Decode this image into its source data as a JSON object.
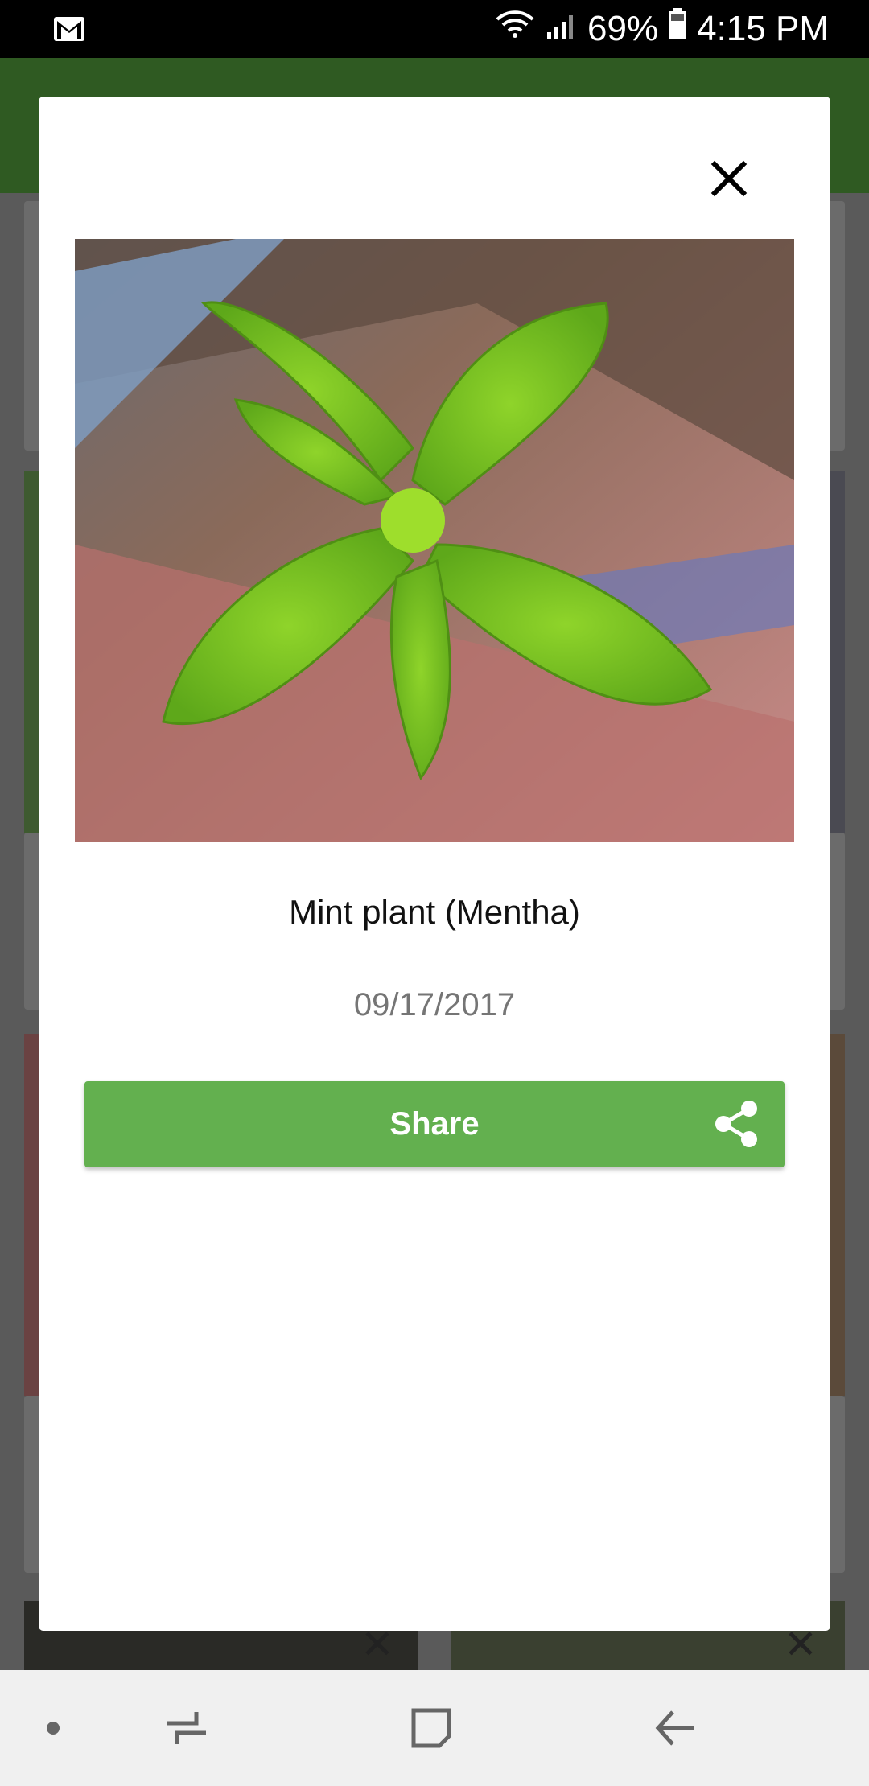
{
  "status_bar": {
    "mail_icon": "gmail-icon",
    "battery_percent": "69%",
    "time": "4:15 PM"
  },
  "modal": {
    "plant_name": "Mint plant (Mentha)",
    "date": "09/17/2017",
    "share_label": "Share",
    "close_icon": "close-icon",
    "share_icon": "share-icon"
  },
  "colors": {
    "accent_green": "#63b04f",
    "app_bar_green": "#2f5a22"
  },
  "nav_bar": {
    "items": [
      "dot-icon",
      "recents-icon",
      "home-icon",
      "back-icon"
    ]
  }
}
